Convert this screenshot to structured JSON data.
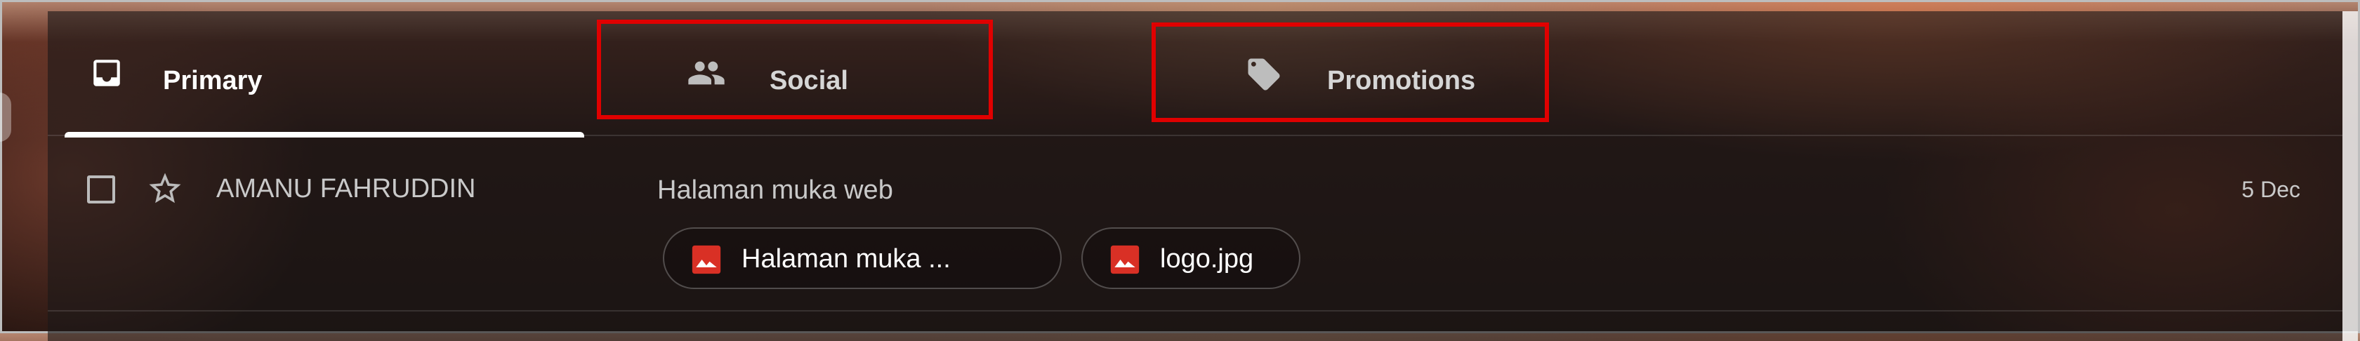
{
  "tabs": [
    {
      "label": "Primary",
      "icon": "inbox-icon",
      "active": true
    },
    {
      "label": "Social",
      "icon": "people-icon",
      "active": false
    },
    {
      "label": "Promotions",
      "icon": "tag-icon",
      "active": false
    }
  ],
  "email": {
    "sender": "AMANU FAHRUDDIN",
    "subject": "Halaman muka web",
    "date": "5 Dec",
    "attachments": [
      {
        "name": "Halaman muka ...",
        "icon": "image-icon"
      },
      {
        "name": "logo.jpg",
        "icon": "image-icon"
      }
    ]
  },
  "colors": {
    "highlight": "#e00000",
    "attachment_icon": "#d93025"
  }
}
